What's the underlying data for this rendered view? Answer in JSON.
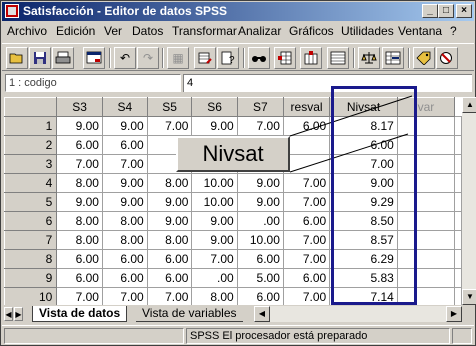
{
  "window": {
    "title": "Satisfacción - Editor de datos SPSS",
    "controls": [
      "_",
      "□",
      "×"
    ]
  },
  "menu": [
    "Archivo",
    "Edición",
    "Ver",
    "Datos",
    "Transformar",
    "Analizar",
    "Gráficos",
    "Utilidades",
    "Ventana",
    "?"
  ],
  "toolbar": {
    "icons": [
      "open-icon",
      "save-icon",
      "print-icon",
      "dialog-recall-icon",
      "undo-icon",
      "redo-icon",
      "chart-builder-icon",
      "go-to-case-icon",
      "variables-icon",
      "find-icon",
      "insert-case-icon",
      "insert-variable-icon",
      "split-file-icon",
      "weight-cases-icon",
      "select-cases-icon",
      "value-labels-icon",
      "use-sets-icon"
    ]
  },
  "cell_editor": {
    "reference": "1 : codigo",
    "value": "4"
  },
  "grid": {
    "columns": [
      "S3",
      "S4",
      "S5",
      "S6",
      "S7",
      "resval",
      "Nivsat",
      "var"
    ],
    "rows": [
      {
        "n": "1",
        "cells": [
          "9.00",
          "9.00",
          "7.00",
          "9.00",
          "7.00",
          "6.00",
          "8.17",
          ""
        ]
      },
      {
        "n": "2",
        "cells": [
          "6.00",
          "6.00",
          "6.",
          "",
          "",
          "",
          "6.00",
          ""
        ]
      },
      {
        "n": "3",
        "cells": [
          "7.00",
          "7.00",
          "7.",
          "",
          "",
          "",
          "7.00",
          ""
        ]
      },
      {
        "n": "4",
        "cells": [
          "8.00",
          "9.00",
          "8.00",
          "10.00",
          "9.00",
          "7.00",
          "9.00",
          ""
        ]
      },
      {
        "n": "5",
        "cells": [
          "9.00",
          "9.00",
          "9.00",
          "10.00",
          "9.00",
          "7.00",
          "9.29",
          ""
        ]
      },
      {
        "n": "6",
        "cells": [
          "8.00",
          "8.00",
          "9.00",
          "9.00",
          ".00",
          "6.00",
          "8.50",
          ""
        ]
      },
      {
        "n": "7",
        "cells": [
          "8.00",
          "8.00",
          "8.00",
          "9.00",
          "10.00",
          "7.00",
          "8.57",
          ""
        ]
      },
      {
        "n": "8",
        "cells": [
          "6.00",
          "6.00",
          "6.00",
          "7.00",
          "6.00",
          "7.00",
          "6.29",
          ""
        ]
      },
      {
        "n": "9",
        "cells": [
          "6.00",
          "6.00",
          "6.00",
          ".00",
          "5.00",
          "6.00",
          "5.83",
          ""
        ]
      },
      {
        "n": "10",
        "cells": [
          "7.00",
          "7.00",
          "7.00",
          "8.00",
          "6.00",
          "7.00",
          "7.14",
          ""
        ]
      }
    ]
  },
  "tabs": {
    "data_view": "Vista de datos",
    "variable_view": "Vista de variables"
  },
  "status": {
    "message": "SPSS El procesador  está preparado"
  },
  "callout": {
    "label": "Nivsat"
  },
  "colors": {
    "title_start": "#0a246a",
    "title_end": "#a6caf0",
    "highlight": "#1a1a8c"
  }
}
